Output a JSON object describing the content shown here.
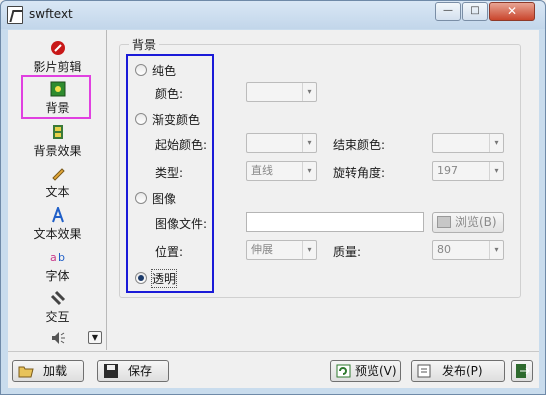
{
  "window": {
    "title": "swftext"
  },
  "sidebar": {
    "items": [
      {
        "label": "影片剪辑",
        "icon": "film-clip-icon"
      },
      {
        "label": "背景",
        "icon": "background-image-icon",
        "selected": true
      },
      {
        "label": "背景效果",
        "icon": "film-strip-icon"
      },
      {
        "label": "文本",
        "icon": "pencil-icon"
      },
      {
        "label": "文本效果",
        "icon": "text-effect-a-icon"
      },
      {
        "label": "字体",
        "icon": "font-ab-icon"
      },
      {
        "label": "交互",
        "icon": "interaction-link-icon"
      },
      {
        "label": "",
        "icon": "speaker-icon"
      }
    ]
  },
  "panel": {
    "group_title": "背景",
    "solid": {
      "label": "纯色",
      "color_label": "颜色:"
    },
    "gradient": {
      "label": "渐变颜色",
      "start_label": "起始颜色:",
      "end_label": "结束颜色:",
      "type_label": "类型:",
      "type_value": "直线",
      "angle_label": "旋转角度:",
      "angle_value": "197"
    },
    "image": {
      "label": "图像",
      "file_label": "图像文件:",
      "file_value": "",
      "browse_label": "浏览(B)",
      "position_label": "位置:",
      "position_value": "伸展",
      "quality_label": "质量:",
      "quality_value": "80"
    },
    "transparent": {
      "label": "透明",
      "checked": true
    }
  },
  "bottom": {
    "load_label": "加载",
    "save_label": "保存",
    "preview_label": "预览(V)",
    "publish_label": "发布(P)"
  },
  "colors": {
    "accent_selected": "#e040e0",
    "highlight_box": "#1a1ad8"
  }
}
